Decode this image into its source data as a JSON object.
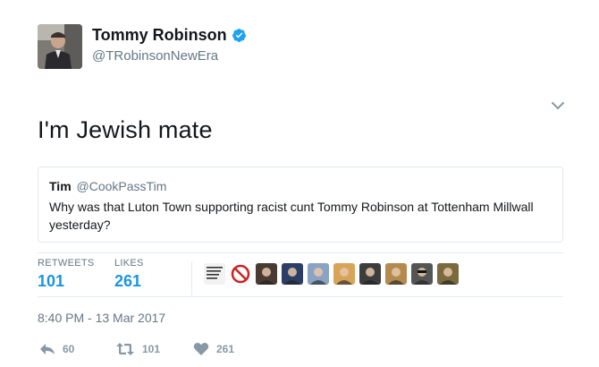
{
  "tweet": {
    "author": {
      "display_name": "Tommy Robinson",
      "handle": "@TRobinsonNewEra",
      "verified": true,
      "avatar_icon": "profile-photo"
    },
    "text": "I'm Jewish mate",
    "quoted": {
      "author_name": "Tim",
      "author_handle": "@CookPassTim",
      "text": "Why was that Luton Town supporting racist cunt Tommy Robinson at Tottenham Millwall yesterday?"
    },
    "stats": {
      "retweets_label": "RETWEETS",
      "retweets_count": "101",
      "likes_label": "LIKES",
      "likes_count": "261"
    },
    "liker_avatars": [
      {
        "icon": "liker-avatar-text-logo",
        "color": "#f2f2f2"
      },
      {
        "icon": "liker-avatar-no-sign",
        "color": "#ffffff"
      },
      {
        "icon": "liker-avatar-person",
        "color": "#4a3a34"
      },
      {
        "icon": "liker-avatar-banner",
        "color": "#2c3e66"
      },
      {
        "icon": "liker-avatar-photo",
        "color": "#8aa3c4"
      },
      {
        "icon": "liker-avatar-photo",
        "color": "#d7a45a"
      },
      {
        "icon": "liker-avatar-group",
        "color": "#3d3d3d"
      },
      {
        "icon": "liker-avatar-photo",
        "color": "#b58a4e"
      },
      {
        "icon": "liker-avatar-sunglasses",
        "color": "#555555"
      },
      {
        "icon": "liker-avatar-photo",
        "color": "#7a6a3e"
      }
    ],
    "timestamp": "8:40 PM - 13 Mar 2017",
    "actions": {
      "reply_count": "60",
      "retweet_count": "101",
      "like_count": "261"
    },
    "colors": {
      "accent": "#1b95e0",
      "verified": "#1da1f2",
      "muted": "#657786",
      "border": "#e1e8ed"
    }
  }
}
